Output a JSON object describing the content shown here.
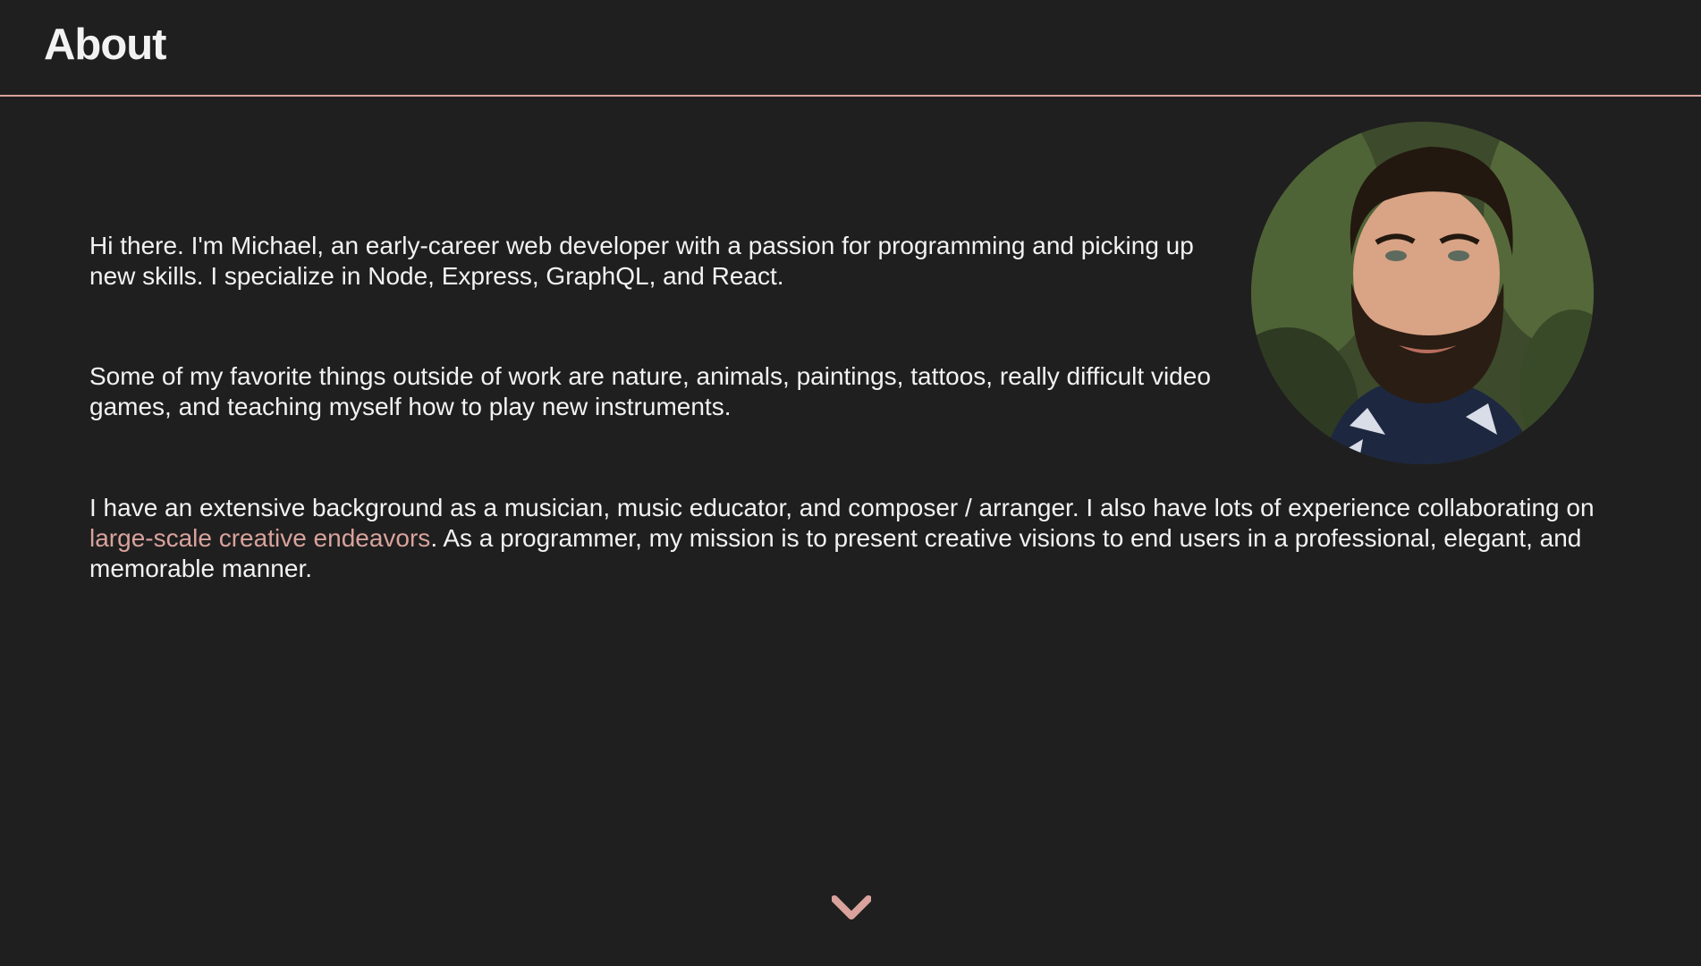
{
  "header": {
    "title": "About"
  },
  "about": {
    "p1": "Hi there. I'm Michael, an early-career web developer with a passion for programming and picking up new skills. I specialize in Node, Express, GraphQL, and React.",
    "p2": "Some of my favorite things outside of work are nature, animals, paintings, tattoos, really difficult video games, and teaching myself how to play new instruments.",
    "p3_before": "I have an extensive background as a musician, music educator, and composer / arranger. I also have lots of experience collaborating on ",
    "p3_link": "large-scale creative endeavors",
    "p3_after": ". As a programmer, my mission is to present creative visions to end users in a professional, elegant, and memorable manner."
  },
  "icons": {
    "scroll": "chevron-down-icon",
    "avatar": "profile-photo"
  },
  "colors": {
    "background": "#1f1f1f",
    "text": "#f2f2f2",
    "accent": "#d9a29c"
  }
}
